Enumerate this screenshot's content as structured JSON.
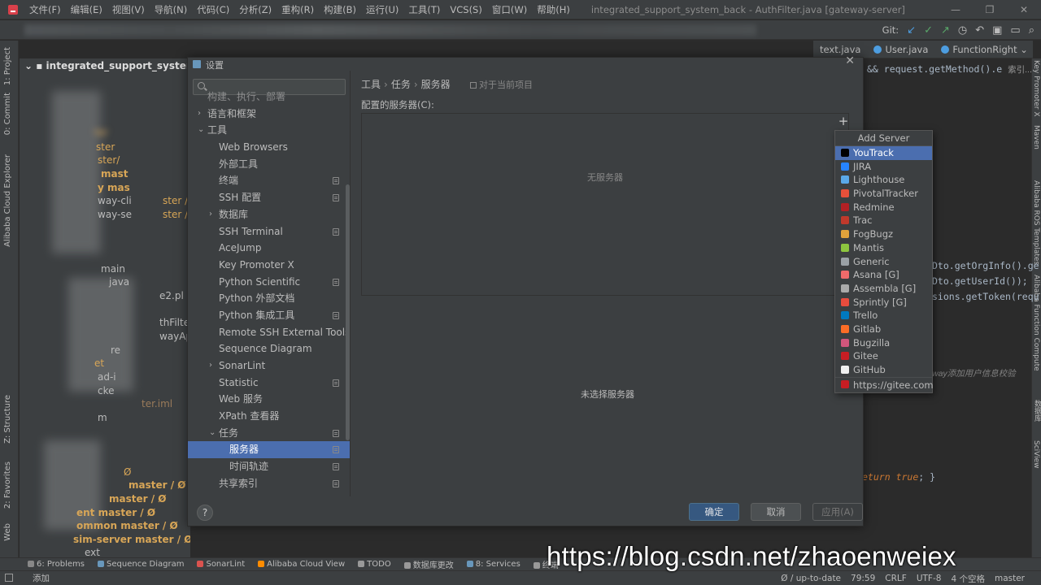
{
  "menubar": {
    "items": [
      "文件(F)",
      "编辑(E)",
      "视图(V)",
      "导航(N)",
      "代码(C)",
      "分析(Z)",
      "重构(R)",
      "构建(B)",
      "运行(U)",
      "工具(T)",
      "VCS(S)",
      "窗口(W)",
      "帮助(H)"
    ],
    "window_title": "integrated_support_system_back - AuthFilter.java [gateway-server]"
  },
  "toolbar": {
    "git_label": "Git:"
  },
  "editor_tabs": [
    "text.java",
    "User.java",
    "FunctionRight"
  ],
  "left_stripe": [
    "1: Project",
    "0: Commit",
    "Alibaba Cloud Explorer",
    "Z: Structure",
    "2: Favorites",
    "Web"
  ],
  "right_stripe": [
    "Key Promoter X",
    "Maven",
    "Alibaba ROS Templates",
    "Alibaba Function Compute",
    "数据库",
    "SciView"
  ],
  "project": {
    "root": "integrated_support_system_ba",
    "rows": [
      "ter",
      "ster",
      "ster/",
      "mast",
      "y mas",
      "way-cli",
      "ster /",
      "way-se",
      "ster /",
      "main",
      "java",
      "e2.pl",
      "thFilte",
      "wayAp",
      "re",
      "et",
      "ad-i",
      "cke",
      "ter.iml",
      "m",
      "Ø",
      "master / Ø",
      "master / Ø",
      "ent  master / Ø",
      "ommon  master / Ø",
      "sim-server  master / Ø",
      "ext"
    ]
  },
  "code": {
    "line1": "&& request.getMethod().e",
    "line1_hint": "索引...",
    "line2": "Dto.getOrgInfo().ge",
    "line3": "Dto.getUserId());",
    "line4": "sions.getToken(requ",
    "comment": "way添加用户信息校验",
    "ret_kw": "eturn",
    "ret_val": "true",
    "ret_end": "; }"
  },
  "dialog": {
    "title": "设置",
    "nav": [
      {
        "label": "构建、执行、部署",
        "level": 1,
        "arrow": "",
        "page_icon": false
      },
      {
        "label": "语言和框架",
        "level": 1,
        "arrow": "›",
        "page_icon": false
      },
      {
        "label": "工具",
        "level": 1,
        "arrow": "⌄",
        "page_icon": false
      },
      {
        "label": "Web Browsers",
        "level": 2,
        "arrow": "",
        "page_icon": false
      },
      {
        "label": "外部工具",
        "level": 2,
        "arrow": "",
        "page_icon": false
      },
      {
        "label": "终端",
        "level": 2,
        "arrow": "",
        "page_icon": true
      },
      {
        "label": "SSH 配置",
        "level": 2,
        "arrow": "",
        "page_icon": true
      },
      {
        "label": "数据库",
        "level": 2,
        "arrow": "›",
        "page_icon": false
      },
      {
        "label": "SSH Terminal",
        "level": 2,
        "arrow": "",
        "page_icon": true
      },
      {
        "label": "AceJump",
        "level": 2,
        "arrow": "",
        "page_icon": false
      },
      {
        "label": "Key Promoter X",
        "level": 2,
        "arrow": "",
        "page_icon": false
      },
      {
        "label": "Python Scientific",
        "level": 2,
        "arrow": "",
        "page_icon": true
      },
      {
        "label": "Python 外部文档",
        "level": 2,
        "arrow": "",
        "page_icon": false
      },
      {
        "label": "Python 集成工具",
        "level": 2,
        "arrow": "",
        "page_icon": true
      },
      {
        "label": "Remote SSH External Tools",
        "level": 2,
        "arrow": "",
        "page_icon": false
      },
      {
        "label": "Sequence Diagram",
        "level": 2,
        "arrow": "",
        "page_icon": false
      },
      {
        "label": "SonarLint",
        "level": 2,
        "arrow": "›",
        "page_icon": false
      },
      {
        "label": "Statistic",
        "level": 2,
        "arrow": "",
        "page_icon": true
      },
      {
        "label": "Web 服务",
        "level": 2,
        "arrow": "",
        "page_icon": false
      },
      {
        "label": "XPath 查看器",
        "level": 2,
        "arrow": "",
        "page_icon": false
      },
      {
        "label": "任务",
        "level": 2,
        "arrow": "⌄",
        "page_icon": true
      },
      {
        "label": "服务器",
        "level": 3,
        "arrow": "",
        "page_icon": true,
        "selected": true
      },
      {
        "label": "时间轨迹",
        "level": 3,
        "arrow": "",
        "page_icon": true
      },
      {
        "label": "共享索引",
        "level": 2,
        "arrow": "",
        "page_icon": true
      }
    ],
    "breadcrumb": [
      "工具",
      "任务",
      "服务器"
    ],
    "scope": "对于当前项目",
    "servers_label": "配置的服务器(C):",
    "no_servers": "无服务器",
    "no_selected": "未选择服务器",
    "help": "?",
    "ok": "确定",
    "cancel": "取消",
    "apply": "应用(A)"
  },
  "popup": {
    "title": "Add Server",
    "items": [
      {
        "label": "YouTrack",
        "color": "#000000",
        "selected": true
      },
      {
        "label": "JIRA",
        "color": "#2684ff"
      },
      {
        "label": "Lighthouse",
        "color": "#5aa8e8"
      },
      {
        "label": "PivotalTracker",
        "color": "#e8503a"
      },
      {
        "label": "Redmine",
        "color": "#b32024"
      },
      {
        "label": "Trac",
        "color": "#c0392b"
      },
      {
        "label": "FogBugz",
        "color": "#e1a33b"
      },
      {
        "label": "Mantis",
        "color": "#8dc63f"
      },
      {
        "label": "Generic",
        "color": "#9aa1a6"
      },
      {
        "label": "Asana [G]",
        "color": "#f06a6a"
      },
      {
        "label": "Assembla [G]",
        "color": "#aaaaaa"
      },
      {
        "label": "Sprintly [G]",
        "color": "#e84c3d"
      },
      {
        "label": "Trello",
        "color": "#0079bf"
      },
      {
        "label": "Gitlab",
        "color": "#fc6d26"
      },
      {
        "label": "Bugzilla",
        "color": "#d2567c"
      },
      {
        "label": "Gitee",
        "color": "#c71d23"
      },
      {
        "label": "GitHub",
        "color": "#f0f0f0"
      }
    ],
    "last_item": {
      "label": "https://gitee.com",
      "color": "#c71d23"
    }
  },
  "bottombar": {
    "tabs": [
      {
        "label": "6: Problems",
        "color": "#888888"
      },
      {
        "label": "Sequence Diagram",
        "color": "#6897bb"
      },
      {
        "label": "SonarLint",
        "color": "#d9534f"
      },
      {
        "label": "Alibaba Cloud View",
        "color": "#ff8c00"
      },
      {
        "label": "TODO",
        "color": "#999999"
      },
      {
        "label": "数据库更改",
        "color": "#999999"
      },
      {
        "label": "8: Services",
        "color": "#6897bb"
      },
      {
        "label": "终端",
        "color": "#999999"
      }
    ]
  },
  "statusbar": {
    "left": "添加",
    "git_status": "Ø / up-to-date",
    "position": "79:59",
    "line_sep": "CRLF",
    "encoding": "UTF-8",
    "indent": "4 个空格",
    "branch": "master"
  },
  "watermark": "https://blog.csdn.net/zhaoenweiex"
}
